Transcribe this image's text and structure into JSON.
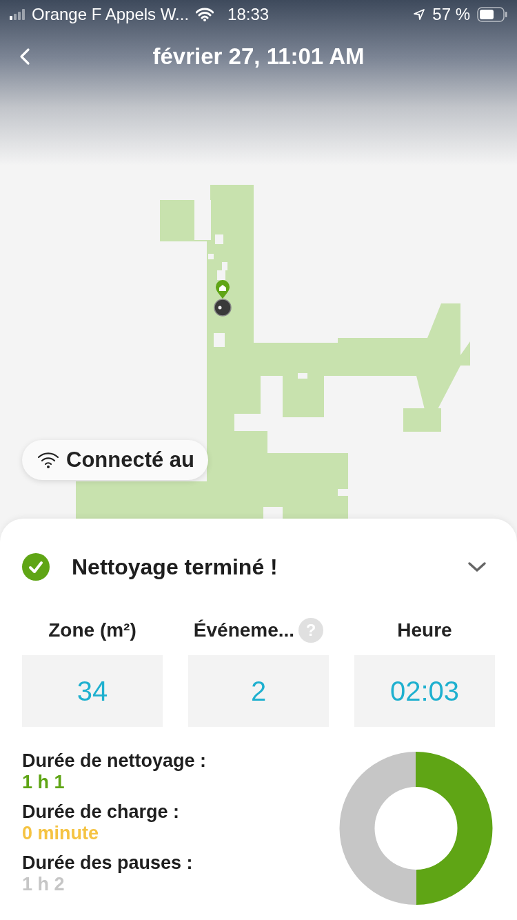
{
  "status_bar": {
    "carrier": "Orange F Appels W...",
    "time": "18:33",
    "battery": "57 %"
  },
  "header": {
    "title": "février 27, 11:01 AM"
  },
  "connection_badge": {
    "label": "Connecté au"
  },
  "summary": {
    "title": "Nettoyage terminé !",
    "expanded": true,
    "stats": [
      {
        "label": "Zone (m²)",
        "value": "34"
      },
      {
        "label": "Événeme...",
        "help": "?",
        "value": "2"
      },
      {
        "label": "Heure",
        "value": "02:03"
      }
    ],
    "durations": [
      {
        "label": "Durée de nettoyage :",
        "value": "1 h 1",
        "color": "#5fa515"
      },
      {
        "label": "Durée de charge :",
        "value": "0 minute",
        "color": "#f5c342"
      },
      {
        "label": "Durée des pauses :",
        "value": "1 h 2",
        "color": "#c6c6c6"
      }
    ]
  }
}
